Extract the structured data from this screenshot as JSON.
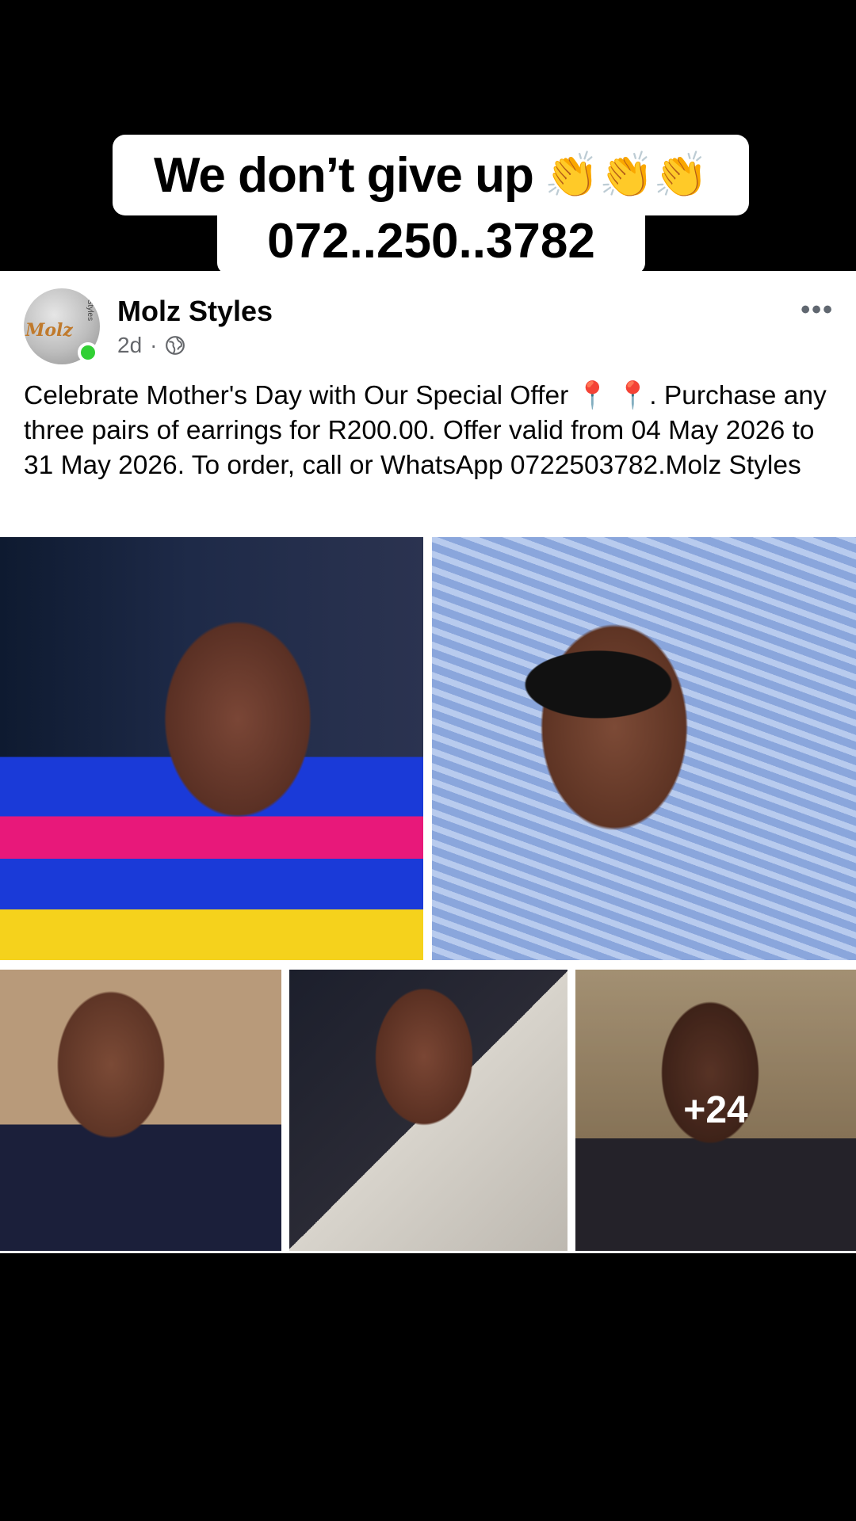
{
  "overlay": {
    "line1": "We don’t give up",
    "claps": "👏👏👏",
    "line2": "072..250..3782"
  },
  "post": {
    "page_name": "Molz Styles",
    "avatar_logo": "Molz",
    "avatar_logo_sub": "Styles",
    "time": "2d",
    "separator": "·",
    "privacy_icon": "globe-icon",
    "more": "•••",
    "text": "Celebrate Mother's Day with Our Special Offer 📍 📍. Purchase any three pairs of earrings for R200.00. Offer valid from 04 May 2026 to 31 May 2026. To order, call or WhatsApp 0722503782.Molz Styles",
    "more_photos": "+24"
  },
  "colors": {
    "online": "#31d034",
    "meta": "#65676b",
    "text": "#050505"
  }
}
